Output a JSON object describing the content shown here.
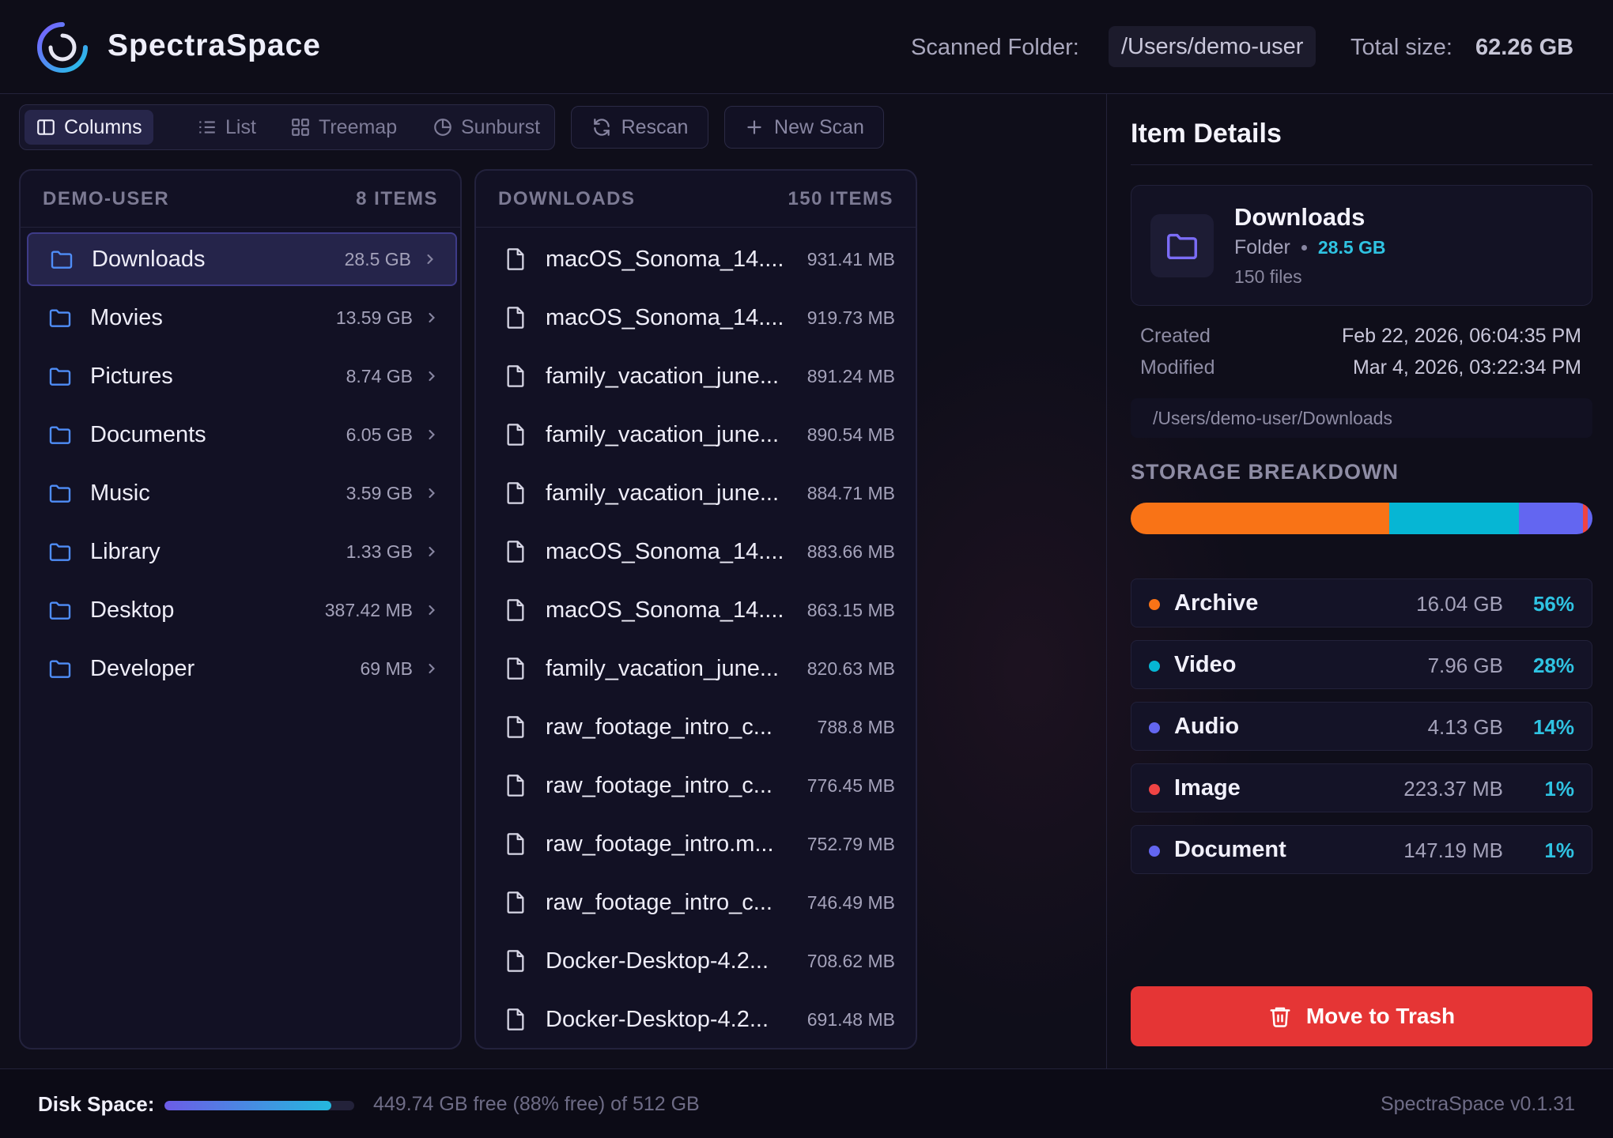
{
  "app": {
    "name": "SpectraSpace",
    "scanned_label": "Scanned Folder:",
    "scanned_path": "/Users/demo-user",
    "total_label": "Total size:",
    "total_value": "62.26 GB"
  },
  "toolbar": {
    "views": [
      "Columns",
      "List",
      "Treemap",
      "Sunburst"
    ],
    "active_view": "Columns",
    "rescan_label": "Rescan",
    "newscan_label": "New Scan"
  },
  "column1": {
    "title": "DEMO-USER",
    "count": "8 ITEMS",
    "items": [
      {
        "name": "Downloads",
        "size": "28.5 GB",
        "selected": true
      },
      {
        "name": "Movies",
        "size": "13.59 GB"
      },
      {
        "name": "Pictures",
        "size": "8.74 GB"
      },
      {
        "name": "Documents",
        "size": "6.05 GB"
      },
      {
        "name": "Music",
        "size": "3.59 GB"
      },
      {
        "name": "Library",
        "size": "1.33 GB"
      },
      {
        "name": "Desktop",
        "size": "387.42 MB"
      },
      {
        "name": "Developer",
        "size": "69 MB"
      }
    ]
  },
  "column2": {
    "title": "DOWNLOADS",
    "count": "150 ITEMS",
    "items": [
      {
        "name": "macOS_Sonoma_14....",
        "size": "931.41 MB"
      },
      {
        "name": "macOS_Sonoma_14....",
        "size": "919.73 MB"
      },
      {
        "name": "family_vacation_june...",
        "size": "891.24 MB"
      },
      {
        "name": "family_vacation_june...",
        "size": "890.54 MB"
      },
      {
        "name": "family_vacation_june...",
        "size": "884.71 MB"
      },
      {
        "name": "macOS_Sonoma_14....",
        "size": "883.66 MB"
      },
      {
        "name": "macOS_Sonoma_14....",
        "size": "863.15 MB"
      },
      {
        "name": "family_vacation_june...",
        "size": "820.63 MB"
      },
      {
        "name": "raw_footage_intro_c...",
        "size": "788.8 MB"
      },
      {
        "name": "raw_footage_intro_c...",
        "size": "776.45 MB"
      },
      {
        "name": "raw_footage_intro.m...",
        "size": "752.79 MB"
      },
      {
        "name": "raw_footage_intro_c...",
        "size": "746.49 MB"
      },
      {
        "name": "Docker-Desktop-4.2...",
        "size": "708.62 MB"
      },
      {
        "name": "Docker-Desktop-4.2...",
        "size": "691.48 MB"
      }
    ]
  },
  "details": {
    "title": "Item Details",
    "name": "Downloads",
    "type": "Folder",
    "size": "28.5 GB",
    "files": "150 files",
    "created_label": "Created",
    "created_value": "Feb 22, 2026, 06:04:35 PM",
    "modified_label": "Modified",
    "modified_value": "Mar 4, 2026, 03:22:34 PM",
    "path": "/Users/demo-user/Downloads",
    "breakdown_title": "STORAGE BREAKDOWN",
    "categories": [
      {
        "name": "Archive",
        "size": "16.04 GB",
        "pct": "56%",
        "fraction": 0.56,
        "color": "#f97316"
      },
      {
        "name": "Video",
        "size": "7.96 GB",
        "pct": "28%",
        "fraction": 0.28,
        "color": "#06b6d4"
      },
      {
        "name": "Audio",
        "size": "4.13 GB",
        "pct": "14%",
        "fraction": 0.14,
        "color": "#6366f1"
      },
      {
        "name": "Image",
        "size": "223.37 MB",
        "pct": "1%",
        "fraction": 0.01,
        "color": "#ef4444"
      },
      {
        "name": "Document",
        "size": "147.19 MB",
        "pct": "1%",
        "fraction": 0.01,
        "color": "#6366f1"
      }
    ],
    "trash_label": "Move to Trash"
  },
  "footer": {
    "disk_label": "Disk Space:",
    "disk_used_fraction": 0.88,
    "disk_text": "449.74 GB free (88% free) of 512 GB",
    "version": "SpectraSpace v0.1.31"
  },
  "colors": {
    "accent": "#6c5ce7",
    "cyan": "#2fc3e2",
    "danger": "#e53535"
  }
}
